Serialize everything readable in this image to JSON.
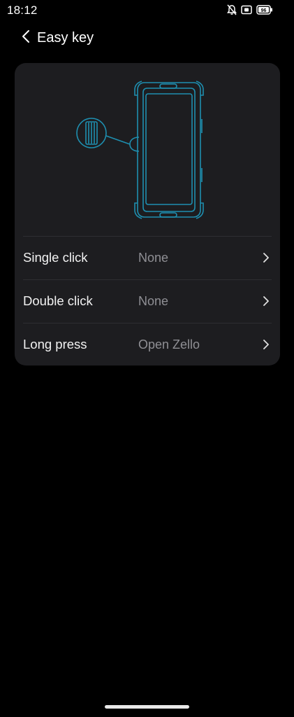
{
  "status_bar": {
    "time": "18:12",
    "icons": [
      "bell-off-icon",
      "sim-icon",
      "battery-icon"
    ],
    "battery_level": "96"
  },
  "header": {
    "back_icon": "chevron-left-icon",
    "title": "Easy key"
  },
  "card": {
    "illustration": "phone-side-key-diagram",
    "accent_color": "#1e8fb0",
    "rows": [
      {
        "label": "Single click",
        "value": "None"
      },
      {
        "label": "Double click",
        "value": "None"
      },
      {
        "label": "Long press",
        "value": "Open Zello"
      }
    ]
  },
  "colors": {
    "background": "#000000",
    "card": "#1d1d20",
    "value_text": "#8f8f94",
    "divider": "#2e2e32"
  }
}
